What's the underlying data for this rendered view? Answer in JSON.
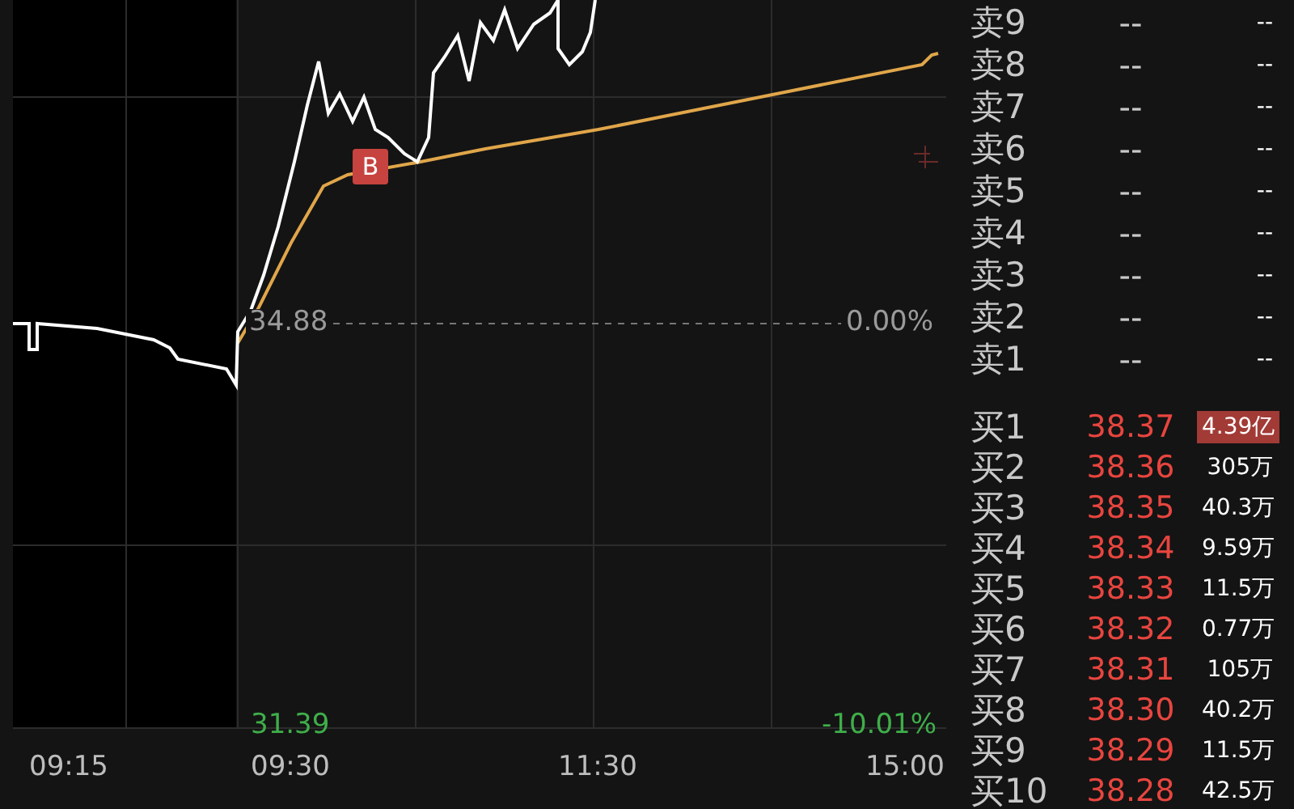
{
  "chart": {
    "price_label": "34.88",
    "change_label": "0.00%",
    "low_label": "31.39",
    "low_change": "-10.01%",
    "marker": "B",
    "time_labels": [
      "09:15",
      "09:30",
      "11:30",
      "15:00"
    ]
  },
  "order_book": {
    "asks": [
      {
        "label": "卖9",
        "price": "--",
        "volume": "--"
      },
      {
        "label": "卖8",
        "price": "--",
        "volume": "--"
      },
      {
        "label": "卖7",
        "price": "--",
        "volume": "--"
      },
      {
        "label": "卖6",
        "price": "--",
        "volume": "--"
      },
      {
        "label": "卖5",
        "price": "--",
        "volume": "--"
      },
      {
        "label": "卖4",
        "price": "--",
        "volume": "--"
      },
      {
        "label": "卖3",
        "price": "--",
        "volume": "--"
      },
      {
        "label": "卖2",
        "price": "--",
        "volume": "--"
      },
      {
        "label": "卖1",
        "price": "--",
        "volume": "--"
      }
    ],
    "bids": [
      {
        "label": "买1",
        "price": "38.37",
        "volume": "4.39亿",
        "highlighted": true
      },
      {
        "label": "买2",
        "price": "38.36",
        "volume": "305万",
        "highlighted": false
      },
      {
        "label": "买3",
        "price": "38.35",
        "volume": "40.3万",
        "highlighted": false
      },
      {
        "label": "买4",
        "price": "38.34",
        "volume": "9.59万",
        "highlighted": false
      },
      {
        "label": "买5",
        "price": "38.33",
        "volume": "11.5万",
        "highlighted": false
      },
      {
        "label": "买6",
        "price": "38.32",
        "volume": "0.77万",
        "highlighted": false
      },
      {
        "label": "买7",
        "price": "38.31",
        "volume": "105万",
        "highlighted": false
      },
      {
        "label": "买8",
        "price": "38.30",
        "volume": "40.2万",
        "highlighted": false
      },
      {
        "label": "买9",
        "price": "38.29",
        "volume": "11.5万",
        "highlighted": false
      },
      {
        "label": "买10",
        "price": "38.28",
        "volume": "42.5万",
        "highlighted": false
      }
    ]
  }
}
